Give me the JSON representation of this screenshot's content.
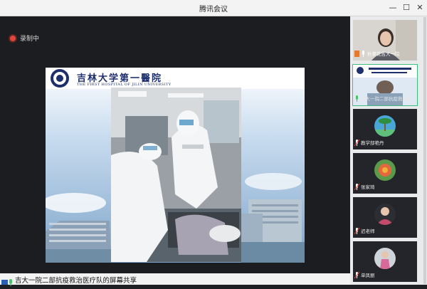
{
  "window": {
    "title": "腾讯会议"
  },
  "recording": {
    "label": "录制中"
  },
  "slide": {
    "hospital_name_cn": "吉林大学第一醫院",
    "hospital_name_en": "THE FIRST HOSPITAL OF JILIN UNIVERSITY"
  },
  "share_bar": {
    "text": "吉大一院二部抗疫救治医疗队的屏幕共享"
  },
  "participants": [
    {
      "name": "朴美花吉大一院",
      "type": "video"
    },
    {
      "name": "吉大一院二部抗疫救治医",
      "type": "screen"
    },
    {
      "name": "教学部艳丹",
      "type": "avatar",
      "avatar_icon": "palm-tree-avatar"
    },
    {
      "name": "张家琦",
      "type": "avatar",
      "avatar_icon": "flower-avatar"
    },
    {
      "name": "迟老师",
      "type": "avatar",
      "avatar_icon": "person-avatar"
    },
    {
      "name": "单凤丽",
      "type": "avatar",
      "avatar_icon": "child-avatar"
    }
  ],
  "colors": {
    "accent_green": "#3fbf7f",
    "record_red": "#e0473a",
    "mic_green": "#4ec26a"
  }
}
